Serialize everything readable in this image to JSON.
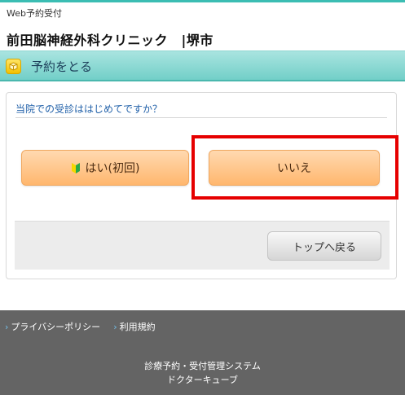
{
  "header": {
    "service_label": "Web予約受付",
    "clinic_name": "前田脳神経外科クリニック　|堺市"
  },
  "titlebar": {
    "icon": "calendar-box-icon",
    "title": "予約をとる"
  },
  "card": {
    "question": "当院での受診ははじめてですか？",
    "yes_label": "はい(初回)",
    "yes_icon": "beginner-leaf-icon",
    "no_label": "いいえ",
    "back_label": "トップへ戻る"
  },
  "footer": {
    "links": [
      "プライバシーポリシー",
      "利用規約"
    ],
    "system_line1": "診療予約・受付管理システム",
    "system_line2": "ドクターキューブ"
  },
  "colors": {
    "accent": "#3bbdb3",
    "button_orange": "#ffb76e",
    "highlight": "#e60000",
    "footer_bg": "#646464"
  }
}
